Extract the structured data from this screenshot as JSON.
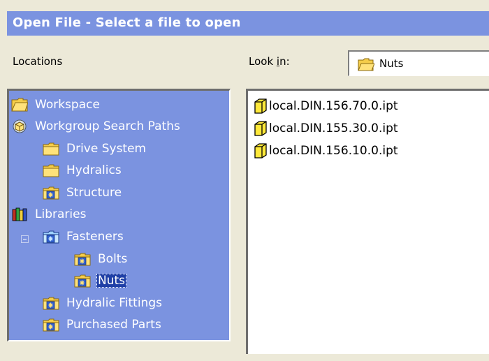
{
  "window": {
    "title": "Open File - Select a file to open"
  },
  "locations": {
    "label": "Locations",
    "items": [
      {
        "label": "Workspace",
        "icon": "workspace-folder-icon"
      },
      {
        "label": "Workgroup Search Paths",
        "icon": "workgroup-icon"
      },
      {
        "label": "Drive System",
        "icon": "folder-icon"
      },
      {
        "label": "Hydralics",
        "icon": "folder-icon"
      },
      {
        "label": "Structure",
        "icon": "library-folder-icon"
      },
      {
        "label": "Libraries",
        "icon": "libraries-icon"
      },
      {
        "label": "Fasteners",
        "icon": "library-folder-icon",
        "expanded": true
      },
      {
        "label": "Bolts",
        "icon": "library-folder-icon"
      },
      {
        "label": "Nuts",
        "icon": "library-folder-icon",
        "selected": true
      },
      {
        "label": "Hydralic Fittings",
        "icon": "library-folder-icon"
      },
      {
        "label": "Purchased Parts",
        "icon": "library-folder-icon"
      }
    ]
  },
  "look_in": {
    "label_prefix": "Look ",
    "label_accel": "i",
    "label_suffix": "n:",
    "value": "Nuts",
    "icon": "open-folder-icon"
  },
  "files": [
    {
      "name": "local.DIN.156.70.0.ipt",
      "icon": "part-file-icon"
    },
    {
      "name": "local.DIN.155.30.0.ipt",
      "icon": "part-file-icon"
    },
    {
      "name": "local.DIN.156.10.0.ipt",
      "icon": "part-file-icon"
    }
  ],
  "colors": {
    "accent": "#7b93e0",
    "selection": "#1f3fa6",
    "dialog_bg": "#ece9d8"
  }
}
